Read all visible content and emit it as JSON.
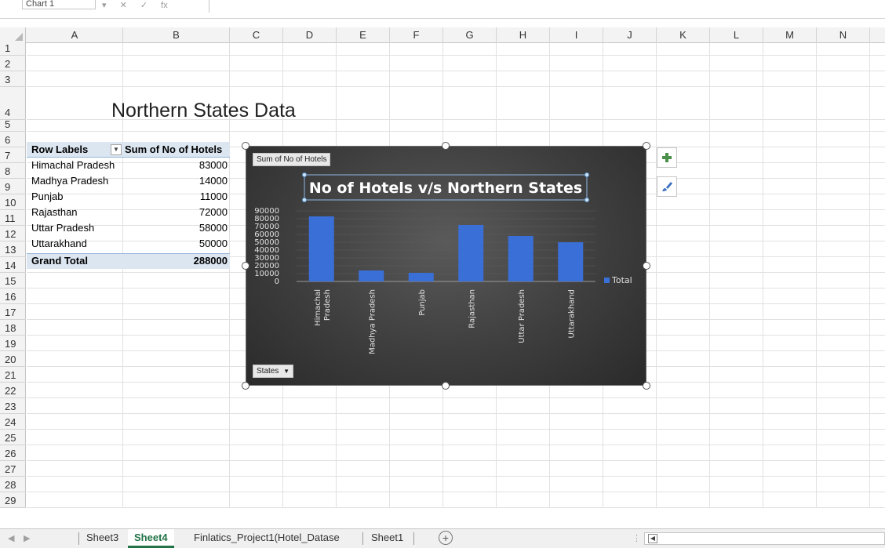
{
  "formula_bar": {
    "name_box": "Chart 1",
    "fx": "fx"
  },
  "columns": [
    "A",
    "B",
    "C",
    "D",
    "E",
    "F",
    "G",
    "H",
    "I",
    "J",
    "K",
    "L",
    "M",
    "N"
  ],
  "rows": [
    "1",
    "2",
    "3",
    "4",
    "5",
    "6",
    "7",
    "8",
    "9",
    "10",
    "11",
    "12",
    "13",
    "14",
    "15",
    "16",
    "17",
    "18",
    "19",
    "20",
    "21",
    "22",
    "23",
    "24",
    "25",
    "26",
    "27",
    "28",
    "29"
  ],
  "sheet_title": "Northern States Data",
  "pivot": {
    "header_label": "Row Labels",
    "header_value": "Sum of No of Hotels",
    "rows": [
      {
        "label": "Himachal Pradesh",
        "value": "83000"
      },
      {
        "label": "Madhya Pradesh",
        "value": "14000"
      },
      {
        "label": "Punjab",
        "value": "11000"
      },
      {
        "label": "Rajasthan",
        "value": "72000"
      },
      {
        "label": "Uttar Pradesh",
        "value": "58000"
      },
      {
        "label": "Uttarakhand",
        "value": "50000"
      }
    ],
    "total_label": "Grand Total",
    "total_value": "288000"
  },
  "chart_buttons": {
    "value_field": "Sum of No of Hotels",
    "axis_field": "States",
    "axis_field_arrow": "▼"
  },
  "chart_data": {
    "type": "bar",
    "title": "No of Hotels v/s Northern States",
    "categories": [
      "Himachal Pradesh",
      "Madhya Pradesh",
      "Punjab",
      "Rajasthan",
      "Uttar Pradesh",
      "Uttarakhand"
    ],
    "series": [
      {
        "name": "Total",
        "values": [
          83000,
          14000,
          11000,
          72000,
          58000,
          50000
        ]
      }
    ],
    "yticks": [
      "90000",
      "80000",
      "70000",
      "60000",
      "50000",
      "40000",
      "30000",
      "20000",
      "10000",
      "0"
    ],
    "ylim": [
      0,
      90000
    ],
    "bar_color": "#3a6fd8",
    "legend_position": "right",
    "grid": true
  },
  "tabs": [
    {
      "label": "Sheet3",
      "active": false
    },
    {
      "label": "Sheet4",
      "active": true
    },
    {
      "label": "Finlatics_Project1(Hotel_Datase",
      "active": false
    },
    {
      "label": "Sheet1",
      "active": false
    }
  ],
  "add_sheet": "+"
}
